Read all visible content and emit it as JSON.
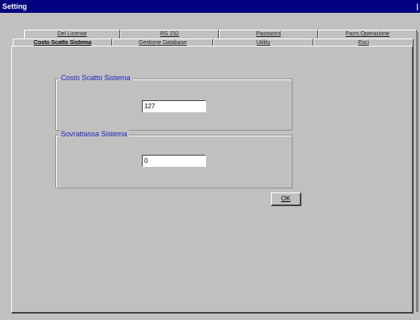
{
  "window": {
    "title": "Setting",
    "close_glyph": "|"
  },
  "tabs": {
    "back_row": [
      {
        "label": "Del License"
      },
      {
        "label": "RS 232"
      },
      {
        "label": "Password"
      },
      {
        "label": "Parm.Operazione"
      }
    ],
    "front_row": [
      {
        "label": "Costo Scatto Sistema",
        "active": true
      },
      {
        "label": "Gestione Database",
        "active": false
      },
      {
        "label": "Utility",
        "active": false
      },
      {
        "label": "Esci",
        "active": false
      }
    ]
  },
  "groups": {
    "costo": {
      "title": "Costo Scatto Sistema",
      "value": "127"
    },
    "sovrattassa": {
      "title": "Sovrattassa Sistema",
      "value": "0"
    }
  },
  "buttons": {
    "ok_label": "OK"
  }
}
